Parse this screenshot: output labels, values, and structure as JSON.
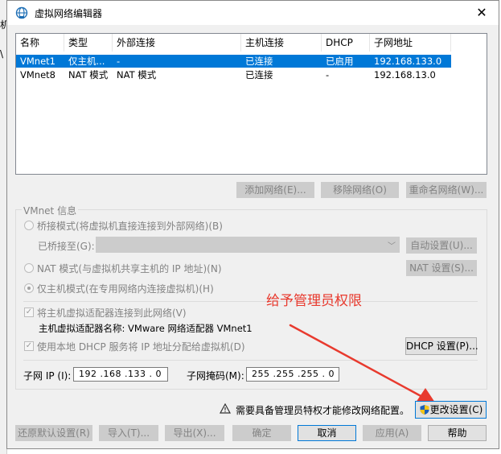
{
  "background": {
    "char": "机",
    "char2": "\\"
  },
  "window": {
    "title": "虚拟网络编辑器",
    "icon": "network-icon",
    "close": "✕"
  },
  "table": {
    "columns": [
      "名称",
      "类型",
      "外部连接",
      "主机连接",
      "DHCP",
      "子网地址"
    ],
    "rows": [
      {
        "name": "VMnet1",
        "type": "仅主机...",
        "external": "-",
        "host": "已连接",
        "dhcp": "已启用",
        "subnet": "192.168.133.0",
        "selected": true
      },
      {
        "name": "VMnet8",
        "type": "NAT 模式",
        "external": "NAT 模式",
        "host": "已连接",
        "dhcp": "-",
        "subnet": "192.168.13.0",
        "selected": false
      }
    ]
  },
  "list_buttons": {
    "add": "添加网络(E)...",
    "remove": "移除网络(O)",
    "rename": "重命名网络(W)..."
  },
  "vmnet_info": {
    "title": "VMnet 信息",
    "bridged_label": "桥接模式(将虚拟机直接连接到外部网络)(B)",
    "bridged_to_label": "已桥接至(G):",
    "bridged_to_value": "",
    "auto_settings": "自动设置(U)...",
    "nat_label": "NAT 模式(与虚拟机共享主机的 IP 地址)(N)",
    "nat_settings": "NAT 设置(S)...",
    "hostonly_label": "仅主机模式(在专用网络内连接虚拟机)(H)",
    "connect_adapter_label": "将主机虚拟适配器连接到此网络(V)",
    "adapter_name_label": "主机虚拟适配器名称: VMware 网络适配器 VMnet1",
    "dhcp_label": "使用本地 DHCP 服务将 IP 地址分配给虚拟机(D)",
    "dhcp_settings": "DHCP 设置(P)...",
    "subnet_ip_label": "子网 IP (I):",
    "subnet_ip_value": "192 .168 .133 . 0",
    "subnet_mask_label": "子网掩码(M):",
    "subnet_mask_value": "255 .255 .255 . 0"
  },
  "annotation": {
    "text": "给予管理员权限",
    "color": "#e83a2e"
  },
  "admin": {
    "notice": "需要具备管理员特权才能修改网络配置。",
    "change_settings": "更改设置(C)"
  },
  "footer": {
    "restore": "还原默认设置(R)",
    "import": "导入(T)...",
    "export": "导出(X)...",
    "ok": "确定",
    "cancel": "取消",
    "apply": "应用(A)",
    "help": "帮助"
  },
  "colors": {
    "selection": "#0078d7",
    "dialog_bg": "#f0f0f0",
    "disabled_text": "#838383"
  }
}
